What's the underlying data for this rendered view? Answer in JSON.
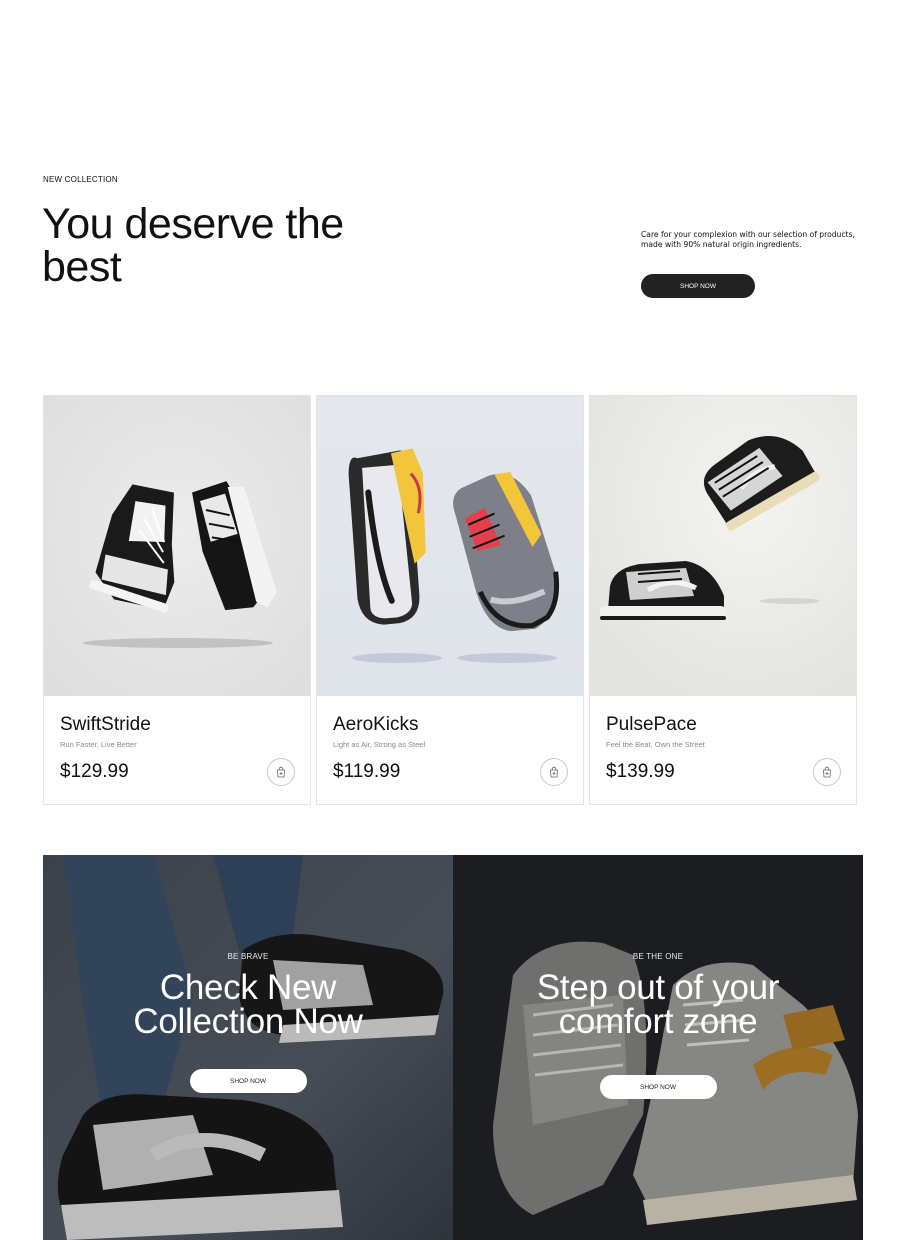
{
  "hero": {
    "eyebrow": "NEW COLLECTION",
    "title": "You deserve the best",
    "description": "Care for your complexion with our selection of products, made with 90% natural origin ingredients.",
    "cta": "SHOP NOW"
  },
  "products": [
    {
      "name": "SwiftStride",
      "tagline": "Run Faster, Live Better",
      "price": "$129.99",
      "image": "black-white-high-top-sneakers"
    },
    {
      "name": "AeroKicks",
      "tagline": "Light as Air, Strong as Steel",
      "price": "$119.99",
      "image": "grey-yellow-running-shoes"
    },
    {
      "name": "PulsePace",
      "tagline": "Feel the Beat, Own the Street",
      "price": "$139.99",
      "image": "black-white-low-top-sneakers"
    }
  ],
  "banners": [
    {
      "eyebrow": "BE BRAVE",
      "title": "Check New Collection Now",
      "cta": "SHOP NOW",
      "image": "person-wearing-sneakers-on-concrete"
    },
    {
      "eyebrow": "BE THE ONE",
      "title": "Step out of your comfort zone",
      "cta": "SHOP NOW",
      "image": "grey-gold-high-top-sneakers"
    }
  ],
  "colors": {
    "accent_dark": "#222222",
    "muted_text": "#8a8a8a",
    "card_border": "#e3e3e3"
  }
}
